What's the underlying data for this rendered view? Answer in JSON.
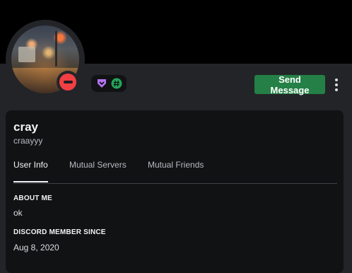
{
  "profile": {
    "display_name": "cray",
    "username": "craayyy",
    "status": "dnd"
  },
  "badges": [
    {
      "icon": "nitro-badge-icon",
      "color": "#b473f5"
    },
    {
      "icon": "hashtag-badge-icon",
      "color": "#23a55a"
    }
  ],
  "actions": {
    "send_message_label": "Send Message",
    "more_icon": "more-vertical-icon"
  },
  "tabs": [
    {
      "label": "User Info",
      "active": true
    },
    {
      "label": "Mutual Servers",
      "active": false
    },
    {
      "label": "Mutual Friends",
      "active": false
    }
  ],
  "about": {
    "heading": "ABOUT ME",
    "text": "ok"
  },
  "member_since": {
    "heading": "DISCORD MEMBER SINCE",
    "date": "Aug 8, 2020"
  },
  "colors": {
    "banner": "#000000",
    "background": "#232428",
    "card": "#111214",
    "accent_green": "#248046",
    "status_dnd": "#f23f43"
  }
}
